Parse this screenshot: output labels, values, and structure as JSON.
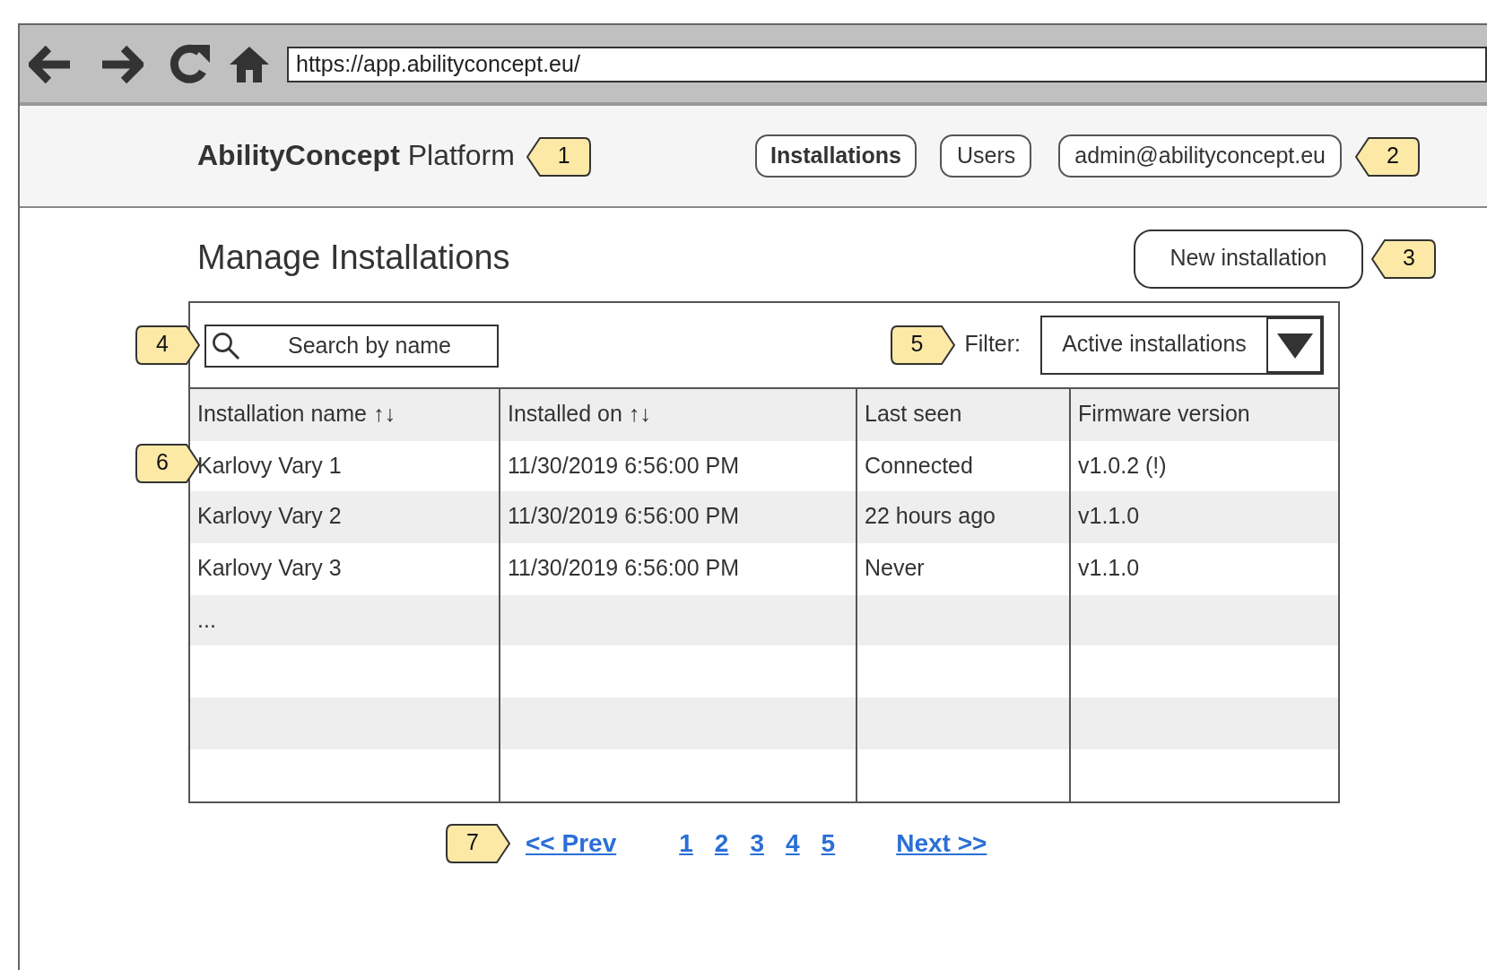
{
  "browser": {
    "url": "https://app.abilityconcept.eu/"
  },
  "header": {
    "brand": "**AbilityConcept** Platform",
    "nav": [
      {
        "label": "Installations",
        "selected": true
      },
      {
        "label": "Users",
        "selected": false
      }
    ],
    "account": "admin@abilityconcept.eu"
  },
  "page_title": "Manage Installations",
  "new_button": "New installation",
  "search": {
    "placeholder": "Search by name"
  },
  "filter": {
    "label": "Filter:",
    "value": "Active installations"
  },
  "table": {
    "columns": [
      "Installation name ↑↓",
      "Installed on ↑↓",
      "Last seen",
      "Firmware version"
    ],
    "rows": [
      [
        "Karlovy Vary 1",
        "11/30/2019 6:56:00 PM",
        "Connected",
        "v1.0.2 (!)"
      ],
      [
        "Karlovy Vary 2",
        "11/30/2019 6:56:00 PM",
        "22 hours ago",
        "v1.1.0"
      ],
      [
        "Karlovy Vary 3",
        "11/30/2019 6:56:00 PM",
        "Never",
        "v1.1.0"
      ],
      [
        "..."
      ]
    ]
  },
  "pagination": {
    "prev": "<< Prev",
    "pages": [
      "1",
      "2",
      "3",
      "4",
      "5"
    ],
    "next": "Next >>"
  },
  "callouts": [
    {
      "number": "1",
      "kind": "left"
    },
    {
      "number": "2",
      "kind": "left"
    },
    {
      "number": "3",
      "kind": "left"
    },
    {
      "number": "4",
      "kind": "right"
    },
    {
      "number": "5",
      "kind": "right"
    },
    {
      "number": "6",
      "kind": "right"
    },
    {
      "number": "7",
      "kind": "right"
    }
  ]
}
